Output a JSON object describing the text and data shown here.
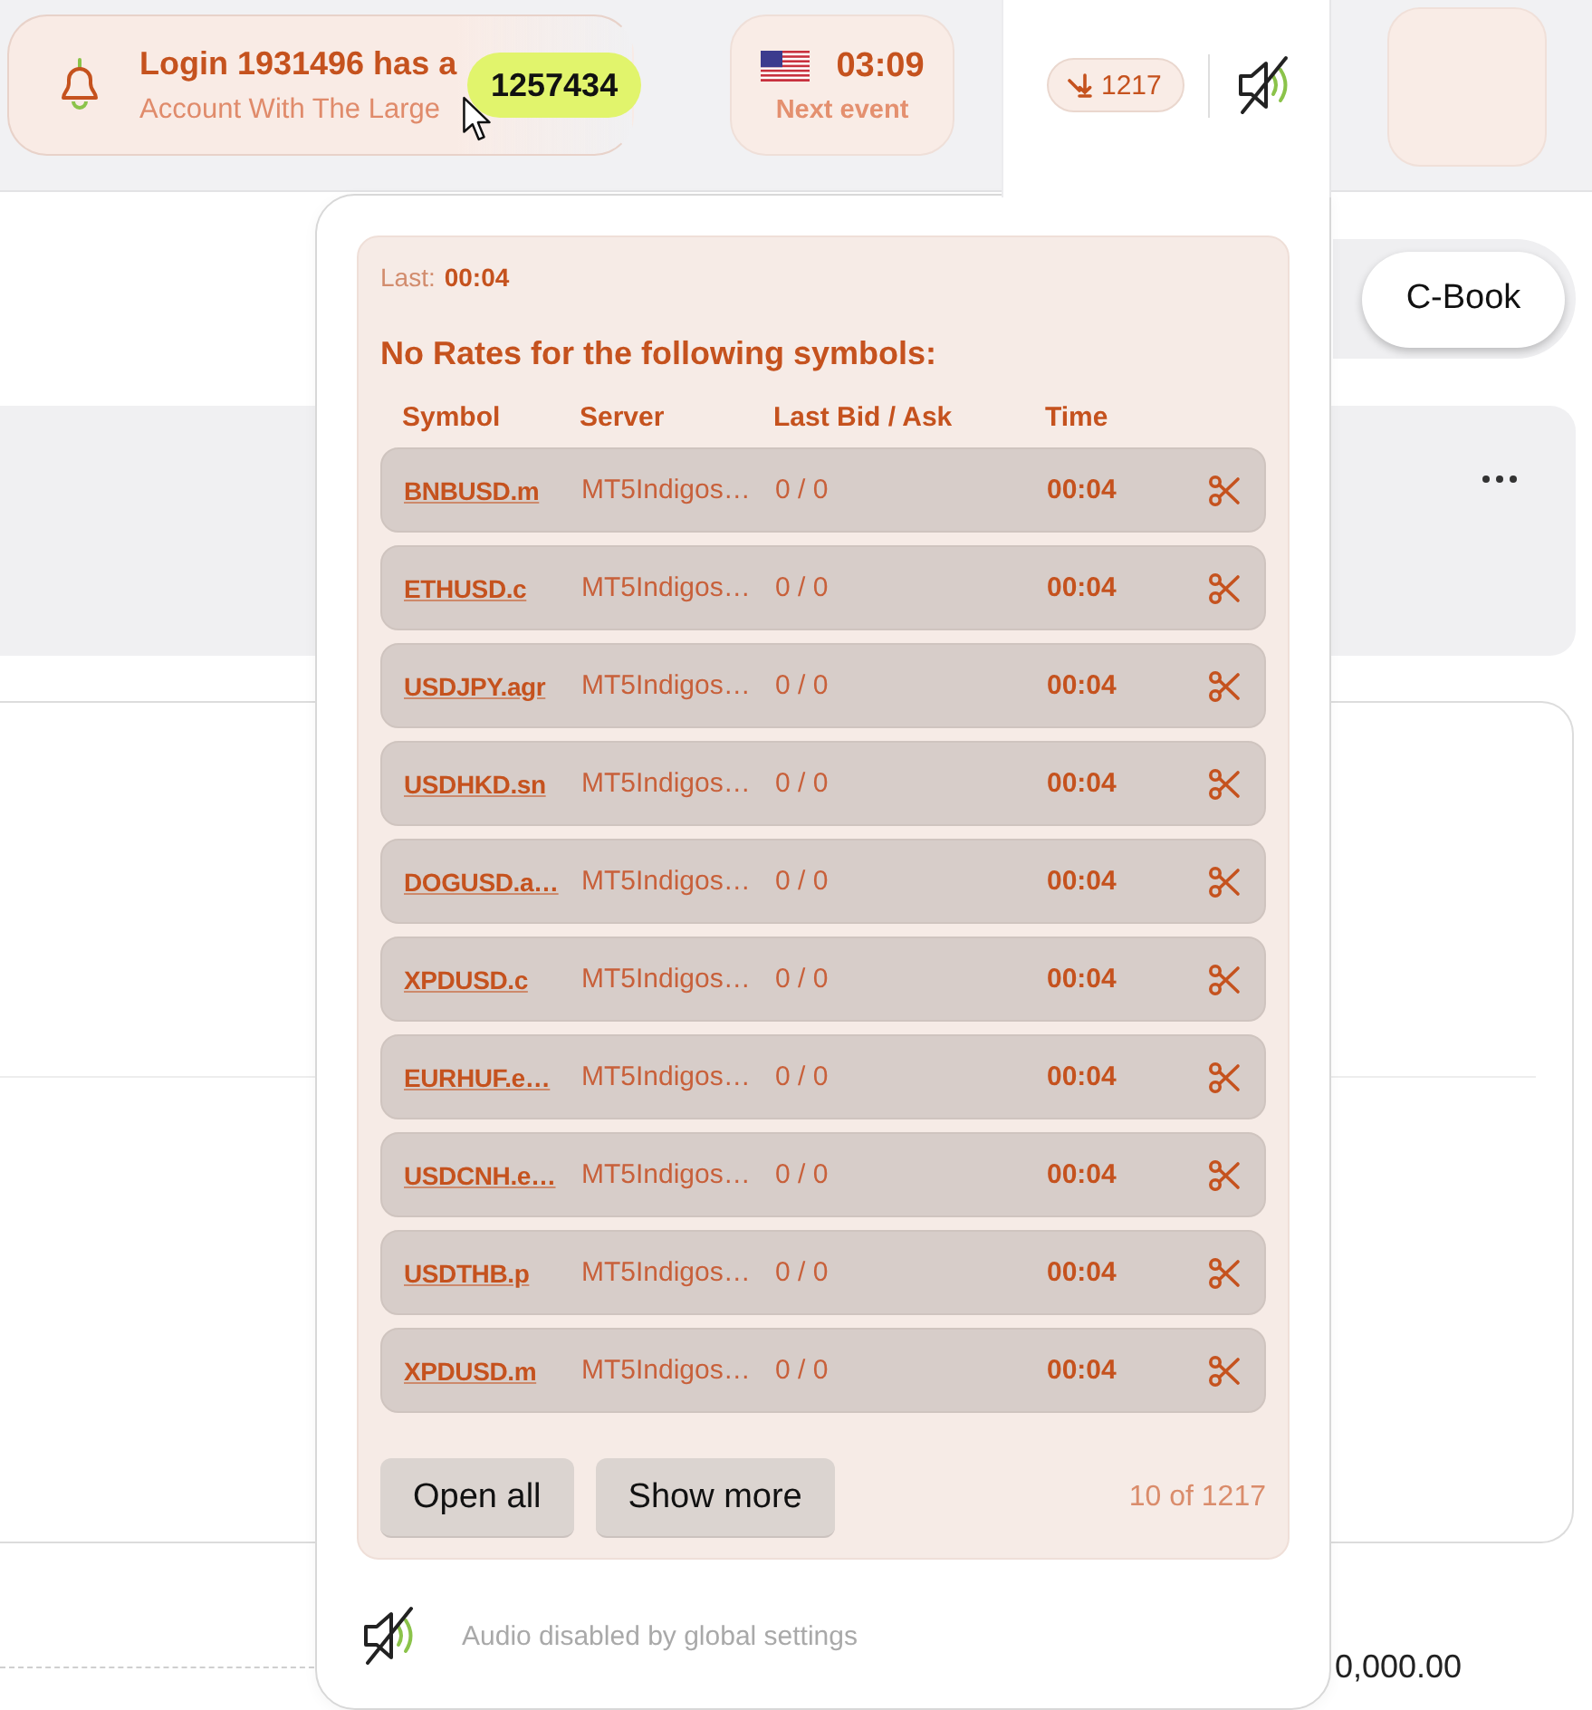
{
  "notification": {
    "title": "Login 1931496 has a",
    "message": "Account With The Large",
    "tooltip": "1257434"
  },
  "next_event": {
    "time": "03:09",
    "label": "Next event"
  },
  "alerts_tab": {
    "selected": true,
    "count": "1217",
    "muted": true
  },
  "book_switch": [
    {
      "label": "C-Book",
      "selected": true
    }
  ],
  "popup": {
    "last_label": "Last:",
    "last_time": "00:04",
    "heading": "No Rates for the following symbols:",
    "columns": [
      "Symbol",
      "Server",
      "Last Bid / Ask",
      "Time"
    ],
    "rows": [
      {
        "symbol": "BNBUSD.m",
        "server": "MT5Indigos…",
        "bid_ask": "0 / 0",
        "time": "00:04"
      },
      {
        "symbol": "ETHUSD.c",
        "server": "MT5Indigos…",
        "bid_ask": "0 / 0",
        "time": "00:04"
      },
      {
        "symbol": "USDJPY.agr",
        "server": "MT5Indigos…",
        "bid_ask": "0 / 0",
        "time": "00:04"
      },
      {
        "symbol": "USDHKD.sn",
        "server": "MT5Indigos…",
        "bid_ask": "0 / 0",
        "time": "00:04"
      },
      {
        "symbol": "DOGUSD.a…",
        "server": "MT5Indigos…",
        "bid_ask": "0 / 0",
        "time": "00:04"
      },
      {
        "symbol": "XPDUSD.c",
        "server": "MT5Indigos…",
        "bid_ask": "0 / 0",
        "time": "00:04"
      },
      {
        "symbol": "EURHUF.e…",
        "server": "MT5Indigos…",
        "bid_ask": "0 / 0",
        "time": "00:04"
      },
      {
        "symbol": "USDCNH.e…",
        "server": "MT5Indigos…",
        "bid_ask": "0 / 0",
        "time": "00:04"
      },
      {
        "symbol": "USDTHB.p",
        "server": "MT5Indigos…",
        "bid_ask": "0 / 0",
        "time": "00:04"
      },
      {
        "symbol": "XPDUSD.m",
        "server": "MT5Indigos…",
        "bid_ask": "0 / 0",
        "time": "00:04"
      }
    ],
    "buttons": [
      "Open all",
      "Show more"
    ],
    "shown_count": "10 of 1217",
    "audio": {
      "muted": true,
      "message": "Audio disabled by global settings"
    }
  },
  "background_amount": "0,000.00"
}
